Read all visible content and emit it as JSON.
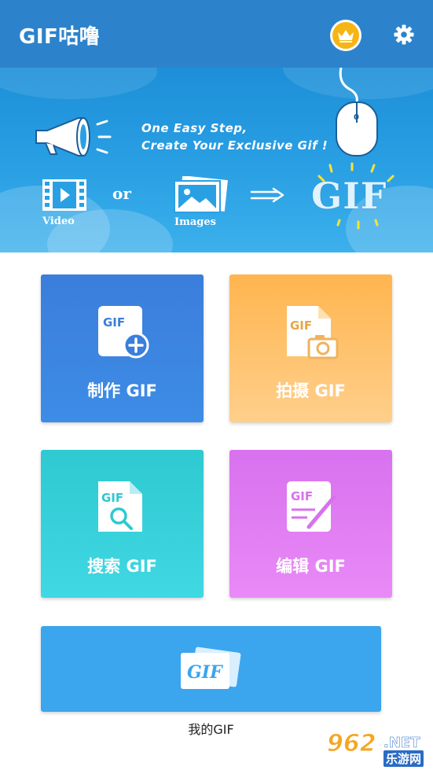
{
  "header": {
    "title": "GIF咕噜",
    "vip_icon": "crown-icon",
    "settings_icon": "gear-icon",
    "bar_color": "#2c83cc"
  },
  "banner": {
    "slogan_line1": "One Easy Step,",
    "slogan_line2": "Create Your Exclusive Gif !",
    "video_label": "Video",
    "or_text": "or",
    "images_label": "Images",
    "gif_text": "GIF"
  },
  "cards": [
    {
      "label": "制作 GIF",
      "icon": "gif-add-icon",
      "color": "#3b7edb"
    },
    {
      "label": "拍摄 GIF",
      "icon": "gif-camera-icon",
      "color": "#ffb54f"
    },
    {
      "label": "搜索 GIF",
      "icon": "gif-search-icon",
      "color": "#2ec9d1"
    },
    {
      "label": "编辑 GIF",
      "icon": "gif-edit-icon",
      "color": "#d871ee"
    }
  ],
  "my_gif": {
    "label": "我的GIF",
    "icon_text": "GIF",
    "color": "#3ba5ee"
  },
  "watermark": {
    "number": "962",
    "suffix": ".NET",
    "cn": "乐游网"
  }
}
